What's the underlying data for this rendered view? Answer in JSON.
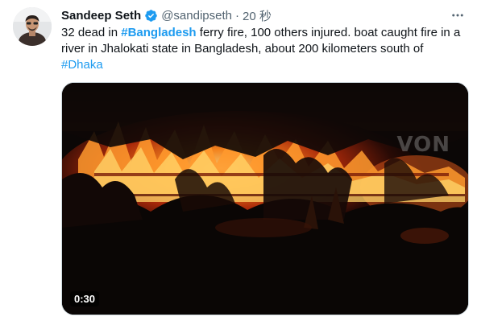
{
  "tweet": {
    "author_name": "Sandeep Seth",
    "handle": "@sandipseth",
    "separator": "·",
    "time": "20 秒",
    "text_part1": "32 dead in ",
    "hashtag1": "#Bangladesh",
    "text_part2": " ferry fire, 100 others injured.  boat caught fire in a river in Jhalokati state in Bangladesh, about 200 kilometers south of ",
    "hashtag2": "#Dhaka"
  },
  "media": {
    "duration": "0:30",
    "watermark": "VON"
  },
  "icons": {
    "verified": "verified-badge-icon",
    "more": "more-options-icon"
  },
  "colors": {
    "accent": "#1d9bf0",
    "text": "#0f1419",
    "secondary": "#536471"
  }
}
